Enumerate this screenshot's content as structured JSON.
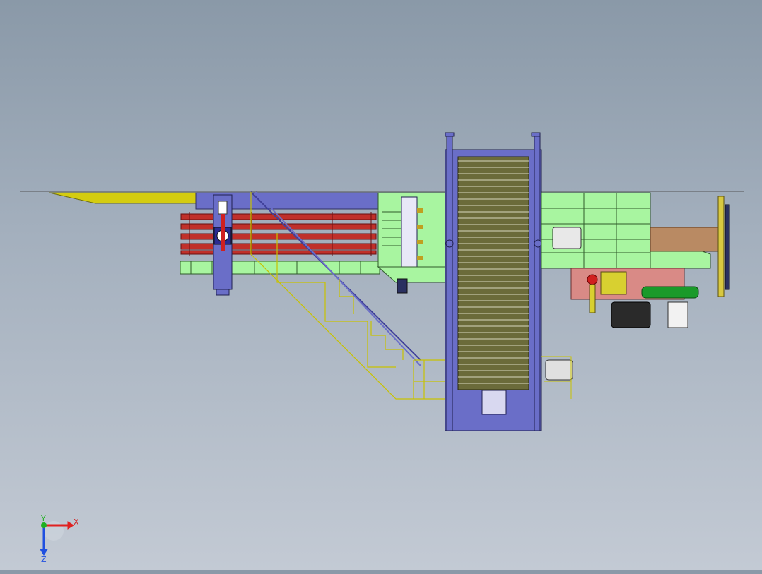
{
  "viewport": {
    "name": "cad-3d-viewport",
    "background_top": "#8a99a8",
    "background_bottom": "#c3cad4"
  },
  "model": {
    "colors": {
      "frame_green": "#a8f5a0",
      "platform_blue": "#6a6ec8",
      "beam_red": "#c0302a",
      "rail_yellow": "#d8d000",
      "conveyor_olive": "#6b6b3a",
      "pipe_tan": "#b98a63",
      "base_pink": "#d98a86",
      "cooler_green": "#1a9a2a"
    }
  },
  "triad": {
    "x_label": "X",
    "y_label": "Y",
    "z_label": "Z",
    "x_color": "#e02020",
    "y_color": "#20b020",
    "z_color": "#2050e0"
  }
}
